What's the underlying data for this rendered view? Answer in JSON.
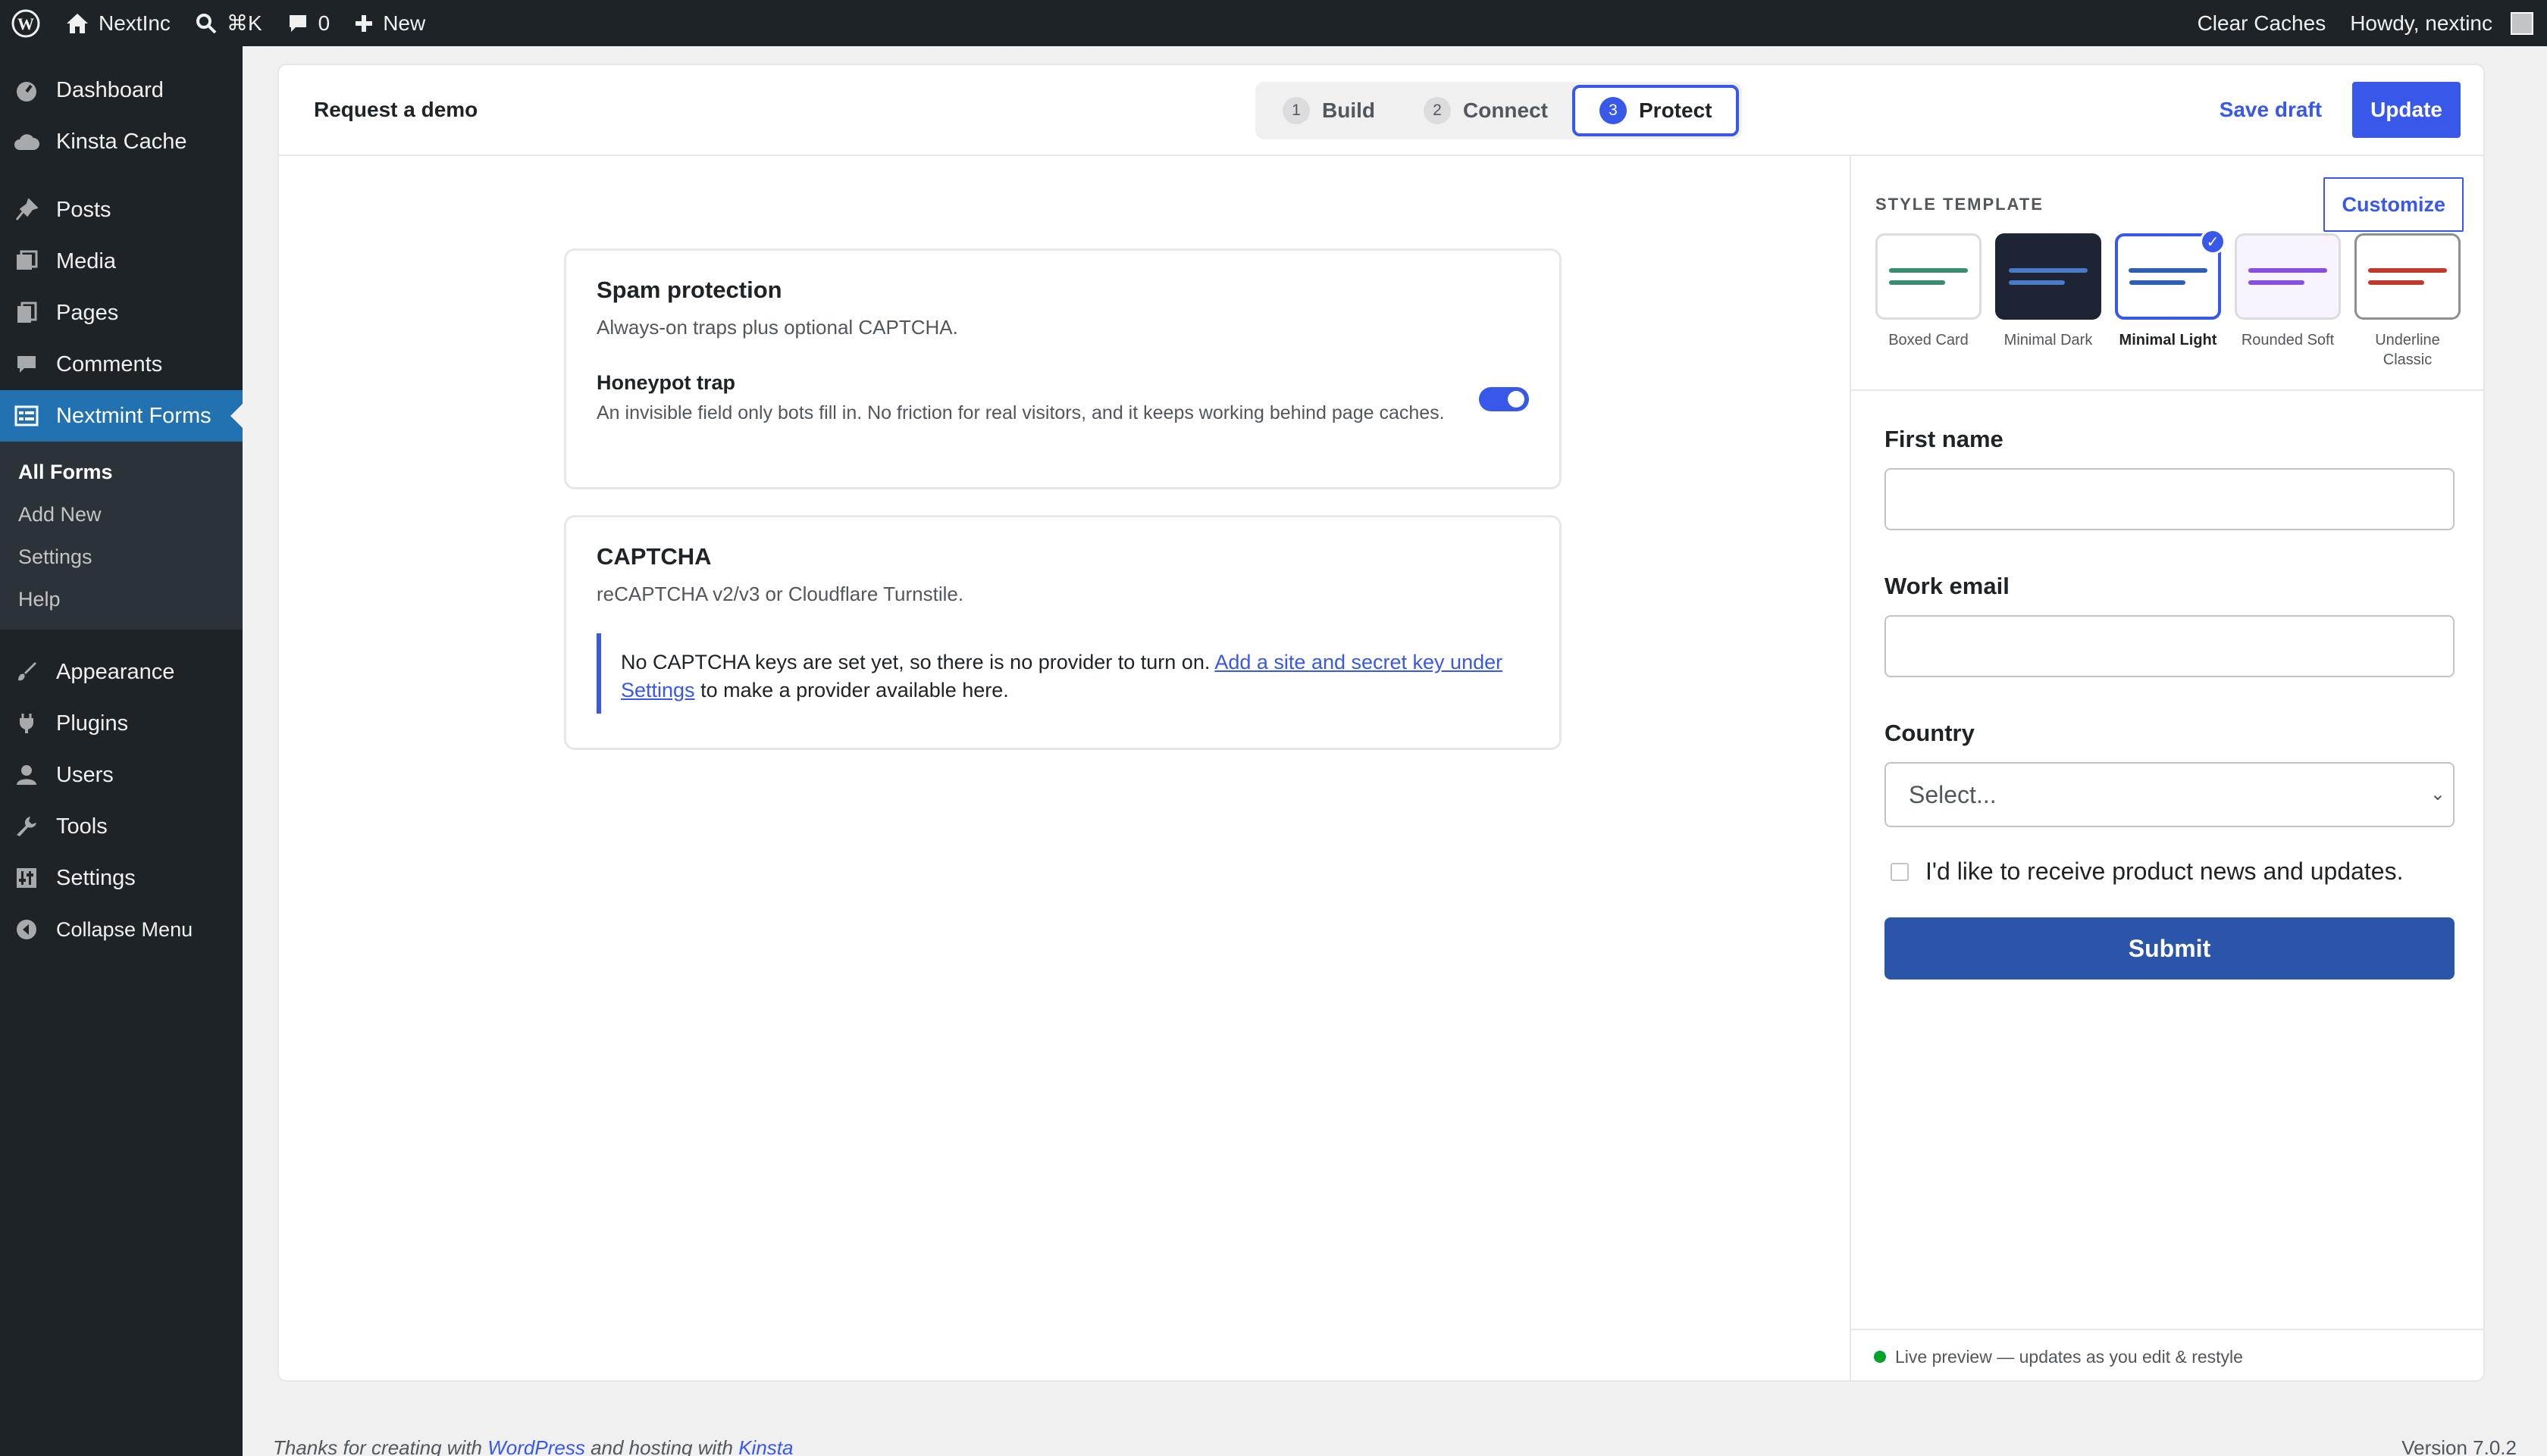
{
  "adminbar": {
    "site_name": "NextInc",
    "search_shortcut": "⌘K",
    "comments_count": "0",
    "new_label": "New",
    "clear_caches": "Clear Caches",
    "howdy": "Howdy, nextinc"
  },
  "sidebar": {
    "items": [
      {
        "label": "Dashboard",
        "icon": "dashboard-icon"
      },
      {
        "label": "Kinsta Cache",
        "icon": "cloud-icon"
      },
      {
        "label": "Posts",
        "icon": "pin-icon"
      },
      {
        "label": "Media",
        "icon": "media-icon"
      },
      {
        "label": "Pages",
        "icon": "pages-icon"
      },
      {
        "label": "Comments",
        "icon": "comment-icon"
      },
      {
        "label": "Nextmint Forms",
        "icon": "forms-icon"
      },
      {
        "label": "Appearance",
        "icon": "brush-icon"
      },
      {
        "label": "Plugins",
        "icon": "plug-icon"
      },
      {
        "label": "Users",
        "icon": "user-icon"
      },
      {
        "label": "Tools",
        "icon": "wrench-icon"
      },
      {
        "label": "Settings",
        "icon": "sliders-icon"
      },
      {
        "label": "Collapse Menu",
        "icon": "collapse-icon"
      }
    ],
    "submenu": [
      "All Forms",
      "Add New",
      "Settings",
      "Help"
    ]
  },
  "editor": {
    "form_title": "Request a demo",
    "steps": [
      {
        "num": "1",
        "label": "Build"
      },
      {
        "num": "2",
        "label": "Connect"
      },
      {
        "num": "3",
        "label": "Protect"
      }
    ],
    "active_step": "Protect",
    "save_draft": "Save draft",
    "update": "Update"
  },
  "spam": {
    "title": "Spam protection",
    "subtitle": "Always-on traps plus optional CAPTCHA.",
    "honeypot_title": "Honeypot trap",
    "honeypot_desc": "An invisible field only bots fill in. No friction for real visitors, and it keeps working behind page caches.",
    "honeypot_enabled": true
  },
  "captcha": {
    "title": "CAPTCHA",
    "subtitle": "reCAPTCHA v2/v3 or Cloudflare Turnstile.",
    "notice_text": "No CAPTCHA keys are set yet, so there is no provider to turn on.",
    "notice_link": "Add a site and secret key under Settings",
    "notice_tail": "to make a provider available here."
  },
  "style": {
    "label": "STYLE TEMPLATE",
    "customize": "Customize",
    "templates": [
      {
        "name": "Boxed Card",
        "color": "#3a8b73"
      },
      {
        "name": "Minimal Dark",
        "color": "#4a7bc8"
      },
      {
        "name": "Minimal Light",
        "color": "#2e5fb5"
      },
      {
        "name": "Rounded Soft",
        "color": "#8a4fe0"
      },
      {
        "name": "Underline Classic",
        "color": "#c0392b"
      }
    ],
    "selected": "Minimal Light"
  },
  "preview": {
    "first_name_label": "First name",
    "work_email_label": "Work email",
    "country_label": "Country",
    "country_placeholder": "Select...",
    "consent_label": "I'd like to receive product news and updates.",
    "submit": "Submit",
    "live_text": "Live preview — updates as you edit & restyle"
  },
  "footer": {
    "thanks_prefix": "Thanks for creating with",
    "wordpress": "WordPress",
    "hosting": "and hosting with",
    "kinsta": "Kinsta",
    "version": "Version 7.0.2"
  },
  "colors": {
    "accent": "#3858e9",
    "admin_bg": "#1d2327",
    "menu_active": "#2271b1",
    "submit_bg": "#2b55a8",
    "live_dot": "#00a32a"
  }
}
